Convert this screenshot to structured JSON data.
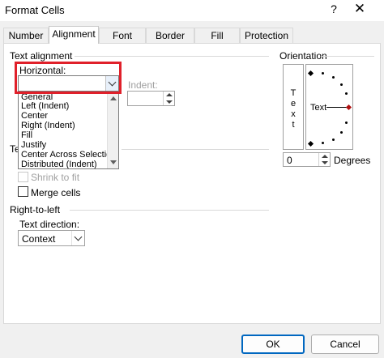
{
  "window": {
    "title": "Format Cells",
    "help": "?",
    "close": "✕"
  },
  "tabs": [
    "Number",
    "Alignment",
    "Font",
    "Border",
    "Fill",
    "Protection"
  ],
  "text_alignment": {
    "group_label": "Text alignment",
    "horizontal_label": "Horizontal:",
    "horizontal_value": "",
    "horizontal_options": [
      "General",
      "Left (Indent)",
      "Center",
      "Right (Indent)",
      "Fill",
      "Justify",
      "Center Across Selection",
      "Distributed (Indent)"
    ],
    "indent_label": "Indent:",
    "indent_value": ""
  },
  "text_control": {
    "group_label_fragment": "Te",
    "shrink_label": "Shrink to fit",
    "merge_label": "Merge cells"
  },
  "rtl": {
    "group_label": "Right-to-left",
    "direction_label": "Text direction:",
    "direction_value": "Context"
  },
  "orientation": {
    "group_label": "Orientation",
    "vertical_letters": [
      "T",
      "e",
      "x",
      "t"
    ],
    "dial_text": "Text",
    "degrees_value": "0",
    "degrees_label": "Degrees"
  },
  "buttons": {
    "ok": "OK",
    "cancel": "Cancel"
  }
}
